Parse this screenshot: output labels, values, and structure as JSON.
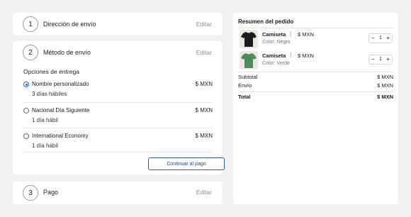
{
  "steps": {
    "address": {
      "number": "1",
      "title": "Dirección de envío",
      "edit": "Editar"
    },
    "shipping": {
      "number": "2",
      "title": "Método de envío",
      "edit": "Editar",
      "options_label": "Opciones de entrega",
      "options": [
        {
          "name": "Nombre personalizado",
          "time": "3 días hábiles",
          "price": "$ MXN",
          "selected": true
        },
        {
          "name": "Nacional Día Siguiente",
          "time": "1 día hábil",
          "price": "$ MXN",
          "selected": false
        },
        {
          "name": "International Economy",
          "time": "1 día hábil",
          "price": "$ MXN",
          "selected": false
        }
      ],
      "continue_label": "Continuar al pago"
    },
    "payment": {
      "number": "3",
      "title": "Pago",
      "edit": "Editar"
    }
  },
  "summary": {
    "title": "Resumen del pedido",
    "items": [
      {
        "name": "Camiseta",
        "separator": "|",
        "price": "$ MXN",
        "color": "Color: Negro",
        "qty": "1",
        "minus": "−",
        "plus": "+",
        "image_icon": "black-tshirt",
        "tint": "#1c1c1c"
      },
      {
        "name": "Camiseta",
        "separator": "|",
        "price": "$ MXN",
        "color": "Color: Verde",
        "qty": "1",
        "minus": "−",
        "plus": "+",
        "image_icon": "green-tshirt",
        "tint": "#4f8a5b"
      }
    ],
    "subtotal_label": "Subtotal",
    "subtotal_value": "$ MXN",
    "shipping_label": "Envío",
    "shipping_value": "$ MXN",
    "total_label": "Total",
    "total_value": "$ MXN"
  },
  "colors": {
    "background": "#f1f1f1",
    "accent": "#2f5fd0",
    "button_border": "#3157b8"
  }
}
